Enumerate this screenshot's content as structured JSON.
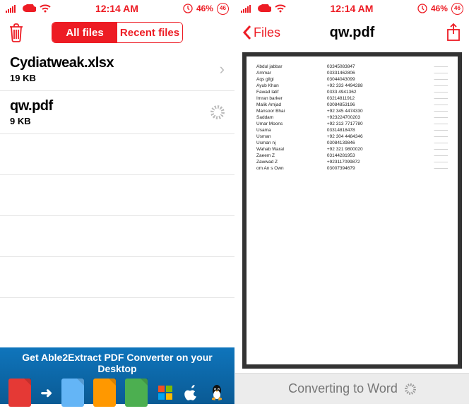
{
  "status": {
    "time": "12:14 AM",
    "battery_text": "46%",
    "badge": "46"
  },
  "left": {
    "segments": {
      "all": "All files",
      "recent": "Recent files"
    },
    "files": [
      {
        "name": "Cydiatweak.xlsx",
        "size": "19 KB"
      },
      {
        "name": "qw.pdf",
        "size": "9 KB"
      }
    ],
    "promo": {
      "title": "Get Able2Extract PDF Converter on your Desktop"
    }
  },
  "right": {
    "back_label": "Files",
    "title": "qw.pdf",
    "converting": "Converting to Word",
    "pdf_rows": [
      {
        "name": "Abdul jabbar",
        "num": "03345083847"
      },
      {
        "name": "Ammar",
        "num": "03331462806"
      },
      {
        "name": "Aqs gilgi",
        "num": "03044043099"
      },
      {
        "name": "Ayub Khan",
        "num": "+92 333 4494288"
      },
      {
        "name": "Fawad latif",
        "num": "0333 4941362"
      },
      {
        "name": "Imran barker",
        "num": "03214811912"
      },
      {
        "name": "Malik Amjad",
        "num": "03084853196"
      },
      {
        "name": "Mansoor Bhai",
        "num": "+92 345 4474330"
      },
      {
        "name": "Saddam",
        "num": "+923224700203"
      },
      {
        "name": "Umar Moons",
        "num": "+92 313 7717780"
      },
      {
        "name": "Usama",
        "num": "03314818478"
      },
      {
        "name": "Usman",
        "num": "+92 304 4484346"
      },
      {
        "name": "Usman nj",
        "num": "03084139846"
      },
      {
        "name": "Wahab Waral",
        "num": "+92 321 9800020"
      },
      {
        "name": "Zaeem Z",
        "num": "03144281953"
      },
      {
        "name": "Zawwad Z",
        "num": "+923117099872"
      },
      {
        "name": "om An s Own",
        "num": "03007394679"
      }
    ]
  }
}
